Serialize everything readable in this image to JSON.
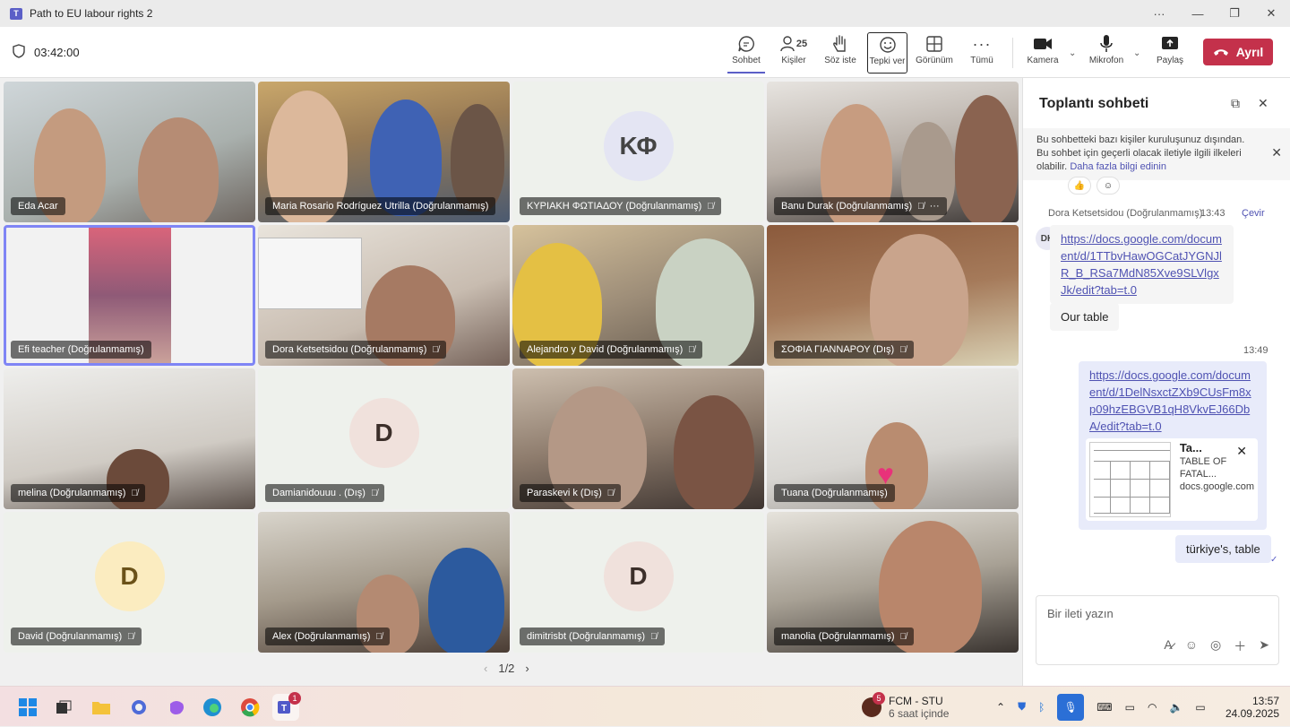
{
  "window": {
    "title": "Path to EU labour rights 2"
  },
  "toolbar": {
    "timer": "03:42:00",
    "chat_label": "Sohbet",
    "people_label": "Kişiler",
    "people_count": "25",
    "raise_hand_label": "Söz iste",
    "react_label": "Tepki ver",
    "view_label": "Görünüm",
    "more_label": "Tümü",
    "camera_label": "Kamera",
    "mic_label": "Mikrofon",
    "share_label": "Paylaş",
    "leave_label": "Ayrıl"
  },
  "participants": [
    {
      "name": "Eda Acar"
    },
    {
      "name": "Maria Rosario Rodríguez Utrilla (Doğrulanmamış)"
    },
    {
      "name": "ΚΥΡΙΑΚΗ ΦΩΤΙΑΔΟΥ (Doğrulanmamış)",
      "initials": "ΚΦ"
    },
    {
      "name": "Banu Durak (Doğrulanmamış)"
    },
    {
      "name": "Efi teacher (Doğrulanmamış)"
    },
    {
      "name": "Dora Ketsetsidou (Doğrulanmamış)"
    },
    {
      "name": "Alejandro y David (Doğrulanmamış)"
    },
    {
      "name": "ΣΟΦΙΑ ΓΙΑΝΝΑΡΟΥ (Dış)"
    },
    {
      "name": "melina (Doğrulanmamış)"
    },
    {
      "name": "Damianidouuu . (Dış)",
      "initials": "D"
    },
    {
      "name": "Paraskevi k (Dış)"
    },
    {
      "name": "Tuana (Doğrulanmamış)"
    },
    {
      "name": "David (Doğrulanmamış)",
      "initials": "D"
    },
    {
      "name": "Alex (Doğrulanmamış)"
    },
    {
      "name": "dimitrisbt (Doğrulanmamış)",
      "initials": "D"
    },
    {
      "name": "manolia (Doğrulanmamış)"
    }
  ],
  "pager": {
    "text": "1/2"
  },
  "chat": {
    "title": "Toplantı sohbeti",
    "notice": "Bu sohbetteki bazı kişiler kuruluşunuz dışından. Bu sohbet için geçerli olacak iletiyle ilgili ilkeleri olabilir.",
    "notice_link": "Daha fazla bilgi edinin",
    "sender": "Dora Ketsetsidou (Doğrulanmamış)",
    "sender_time": "13:43",
    "translate_label": "Çevir",
    "sender_initials": "DK",
    "msg1_link": "https://docs.google.com/document/d/1TTbvHawOGCatJYGNJlR_B_RSa7MdN85Xve9SLVlgxJk/edit?tab=t.0",
    "msg2_text": "Our table",
    "my_time": "13:49",
    "my_link": "https://docs.google.com/document/d/1DelNsxctZXb9CUsFm8xp09hzEBGVB1qH8VkvEJ66DbA/edit?tab=t.0",
    "preview_title": "Ta...",
    "preview_desc": "TABLE OF FATAL...",
    "preview_domain": "docs.google.com",
    "my_text": "türkiye's, table",
    "compose_placeholder": "Bir ileti yazın"
  },
  "taskbar": {
    "notif_app": "FCM - STU",
    "notif_sub": "6 saat içinde",
    "notif_badge": "5",
    "teams_badge": "1",
    "time": "13:57",
    "date": "24.09.2025"
  }
}
